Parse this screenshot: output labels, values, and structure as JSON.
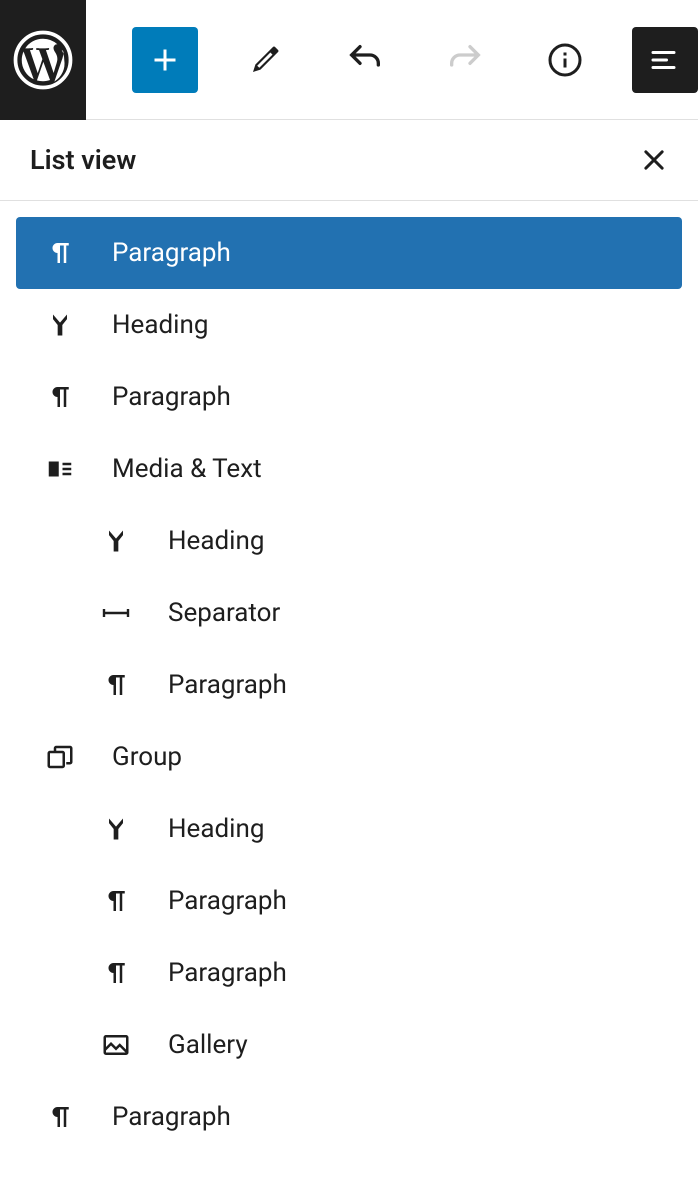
{
  "toolbar": {
    "logo": "wordpress"
  },
  "panel": {
    "title": "List view"
  },
  "blocks": [
    {
      "type": "paragraph",
      "label": "Paragraph",
      "indent": 0,
      "selected": true
    },
    {
      "type": "heading",
      "label": "Heading",
      "indent": 0,
      "selected": false
    },
    {
      "type": "paragraph",
      "label": "Paragraph",
      "indent": 0,
      "selected": false
    },
    {
      "type": "media-text",
      "label": "Media & Text",
      "indent": 0,
      "selected": false
    },
    {
      "type": "heading",
      "label": "Heading",
      "indent": 1,
      "selected": false
    },
    {
      "type": "separator",
      "label": "Separator",
      "indent": 1,
      "selected": false
    },
    {
      "type": "paragraph",
      "label": "Paragraph",
      "indent": 1,
      "selected": false
    },
    {
      "type": "group",
      "label": "Group",
      "indent": 0,
      "selected": false
    },
    {
      "type": "heading",
      "label": "Heading",
      "indent": 1,
      "selected": false
    },
    {
      "type": "paragraph",
      "label": "Paragraph",
      "indent": 1,
      "selected": false
    },
    {
      "type": "paragraph",
      "label": "Paragraph",
      "indent": 1,
      "selected": false
    },
    {
      "type": "gallery",
      "label": "Gallery",
      "indent": 1,
      "selected": false
    },
    {
      "type": "paragraph",
      "label": "Paragraph",
      "indent": 0,
      "selected": false
    }
  ]
}
